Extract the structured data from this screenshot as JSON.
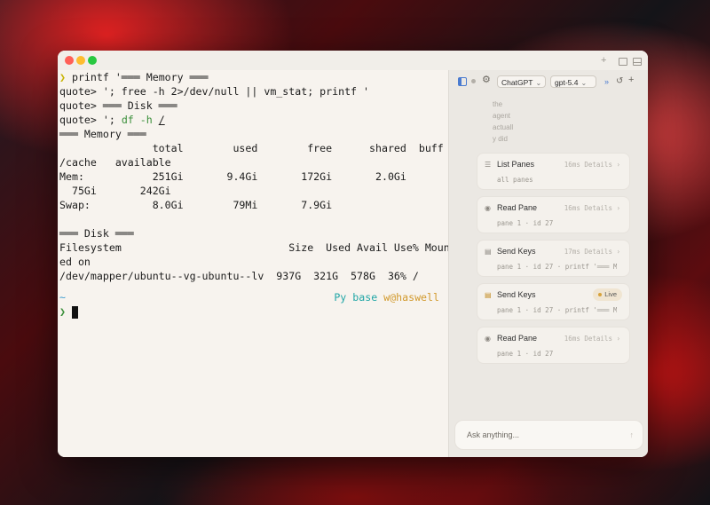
{
  "window": {
    "controls": {
      "new_tab": "+"
    }
  },
  "terminal": {
    "lines": [
      "printf '═══ Memory ═══",
      "quote> '; free -h 2>/dev/null || vm_stat; printf '",
      "quote> ═══ Disk ═══",
      "quote> '; ",
      "═══ Memory ═══",
      "               total        used        free      shared  buff",
      "/cache   available",
      "Mem:           251Gi       9.4Gi       172Gi       2.0Gi",
      "  75Gi       242Gi",
      "Swap:          8.0Gi        79Mi       7.9Gi",
      "",
      "═══ Disk ═══",
      "Filesystem                           Size  Used Avail Use% Mount",
      "ed on",
      "/dev/mapper/ubuntu--vg-ubuntu--lv  937G  321G  578G  36% /"
    ],
    "prompt_symbol": "❯",
    "command_df": "df -h",
    "command_df_arg": "/",
    "cwd": "~",
    "env": "Py base",
    "user_host": "w@haswell"
  },
  "sidebar": {
    "model_provider": "ChatGPT",
    "model_name": "gpt-5.4",
    "faded_text": [
      "the",
      "agent",
      "actuall",
      "y did"
    ],
    "cards": [
      {
        "title": "List Panes",
        "meta": "16ms Details ›",
        "sub": "all panes",
        "icon": "list-icon"
      },
      {
        "title": "Read Pane",
        "meta": "16ms Details ›",
        "sub": "pane 1 · id 27",
        "icon": "eye-icon"
      },
      {
        "title": "Send Keys",
        "meta": "17ms Details ›",
        "sub": "pane 1 · id 27 · printf '═══ M",
        "icon": "keyboard-icon"
      },
      {
        "title": "Send Keys",
        "live": "Live",
        "sub": "pane 1 · id 27 · printf '═══ M",
        "icon": "keyboard-icon"
      },
      {
        "title": "Read Pane",
        "meta": "16ms Details ›",
        "sub": "pane 1 · id 27",
        "icon": "eye-icon"
      }
    ],
    "input": {
      "placeholder": "Ask anything...",
      "send_glyph": "↑"
    },
    "toolbar_glyphs": {
      "add": "+"
    }
  }
}
